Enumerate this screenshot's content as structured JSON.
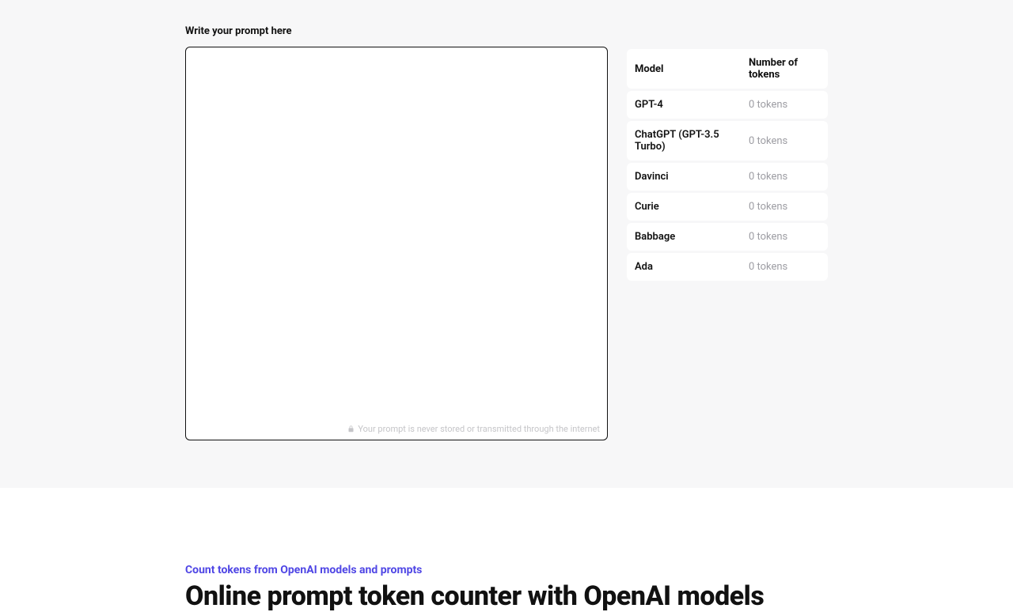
{
  "prompt_label": "Write your prompt here",
  "privacy_note": "Your prompt is never stored or transmitted through the internet",
  "table": {
    "headers": {
      "model": "Model",
      "tokens": "Number of tokens"
    },
    "rows": [
      {
        "model": "GPT-4",
        "tokens": "0 tokens"
      },
      {
        "model": "ChatGPT (GPT-3.5 Turbo)",
        "tokens": "0 tokens"
      },
      {
        "model": "Davinci",
        "tokens": "0 tokens"
      },
      {
        "model": "Curie",
        "tokens": "0 tokens"
      },
      {
        "model": "Babbage",
        "tokens": "0 tokens"
      },
      {
        "model": "Ada",
        "tokens": "0 tokens"
      }
    ]
  },
  "bottom": {
    "subtitle": "Count tokens from OpenAI models and prompts",
    "headline": "Online prompt token counter with OpenAI models"
  }
}
